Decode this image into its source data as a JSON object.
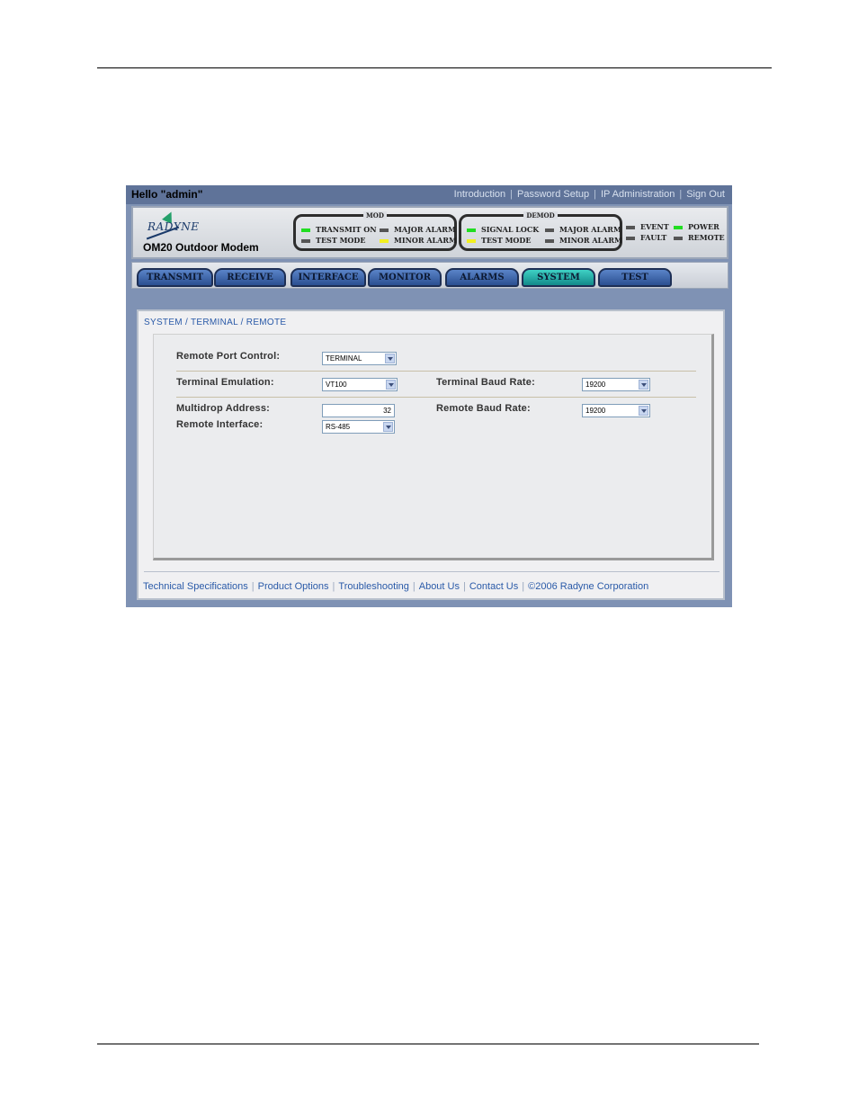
{
  "greeting": "Hello \"admin\"",
  "top_links": [
    "Introduction",
    "Password Setup",
    "IP Administration",
    "Sign Out"
  ],
  "header": {
    "logo": "RADYNE",
    "model": "OM20 Outdoor Modem",
    "mod": {
      "title": "MOD",
      "transmit_on": "TRANSMIT ON",
      "test_mode": "TEST MODE",
      "major_alarm": "MAJOR ALARM",
      "minor_alarm": "MINOR ALARM"
    },
    "demod": {
      "title": "DEMOD",
      "signal_lock": "SIGNAL LOCK",
      "test_mode": "TEST MODE",
      "major_alarm": "MAJOR ALARM",
      "minor_alarm": "MINOR ALARM"
    },
    "status": {
      "event": "EVENT",
      "fault": "FAULT",
      "power": "POWER",
      "remote": "REMOTE"
    },
    "led_colors": {
      "on": "#22dd22",
      "warn": "#f2ef20",
      "off": "#555555"
    }
  },
  "tabs": [
    "TRANSMIT",
    "RECEIVE",
    "INTERFACE",
    "MONITOR",
    "ALARMS",
    "SYSTEM",
    "TEST"
  ],
  "active_tab": "SYSTEM",
  "breadcrumb": "SYSTEM / TERMINAL / REMOTE",
  "form": {
    "remote_port_control_label": "Remote Port Control:",
    "remote_port_control_value": "TERMINAL",
    "terminal_emulation_label": "Terminal Emulation:",
    "terminal_emulation_value": "VT100",
    "terminal_baud_rate_label": "Terminal Baud Rate:",
    "terminal_baud_rate_value": "19200",
    "multidrop_address_label": "Multidrop Address:",
    "multidrop_address_value": "32",
    "remote_baud_rate_label": "Remote Baud Rate:",
    "remote_baud_rate_value": "19200",
    "remote_interface_label": "Remote Interface:",
    "remote_interface_value": "RS-485"
  },
  "footer_links": [
    "Technical Specifications",
    "Product Options",
    "Troubleshooting",
    "About Us",
    "Contact Us",
    "©2006 Radyne Corporation"
  ]
}
